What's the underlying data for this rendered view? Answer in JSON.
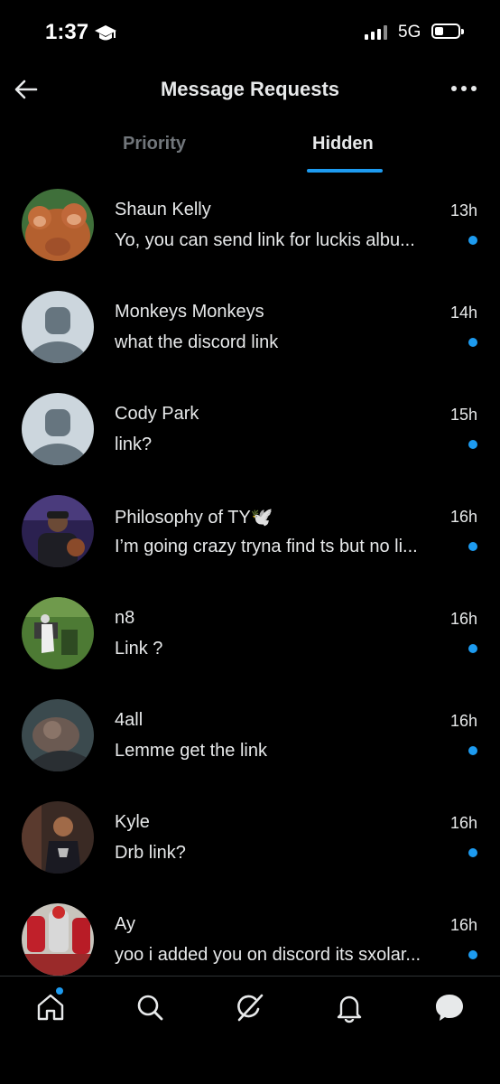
{
  "status_bar": {
    "time": "1:37",
    "network": "5G",
    "icons": [
      "graduation-cap-icon",
      "signal-icon",
      "battery-icon"
    ]
  },
  "header": {
    "title": "Message Requests",
    "back_icon": "back-arrow-icon",
    "more_icon": "more-dots-icon"
  },
  "tabs": [
    {
      "label": "Priority",
      "active": false
    },
    {
      "label": "Hidden",
      "active": true
    }
  ],
  "accent_color": "#1d9bf0",
  "conversations": [
    {
      "name": "Shaun Kelly",
      "message": "Yo, you can send link for luckis albu...",
      "time": "13h",
      "unread": true
    },
    {
      "name": "Monkeys Monkeys",
      "message": "what the discord link",
      "time": "14h",
      "unread": true
    },
    {
      "name": "Cody Park",
      "message": "link?",
      "time": "15h",
      "unread": true
    },
    {
      "name": "Philosophy of TY🕊️",
      "message": "I’m going crazy tryna find ts but no li...",
      "time": "16h",
      "unread": true
    },
    {
      "name": "n8",
      "message": "Link ?",
      "time": "16h",
      "unread": true
    },
    {
      "name": "4all",
      "message": "Lemme get the link",
      "time": "16h",
      "unread": true
    },
    {
      "name": "Kyle",
      "message": "Drb link?",
      "time": "16h",
      "unread": true
    },
    {
      "name": "Ay",
      "message": "yoo i added you on discord its sxolar...",
      "time": "16h",
      "unread": true
    }
  ],
  "bottom_nav": [
    {
      "icon": "home-icon",
      "has_badge": true
    },
    {
      "icon": "search-icon",
      "has_badge": false
    },
    {
      "icon": "grok-icon",
      "has_badge": false
    },
    {
      "icon": "bell-icon",
      "has_badge": false
    },
    {
      "icon": "messages-icon",
      "has_badge": false
    }
  ]
}
